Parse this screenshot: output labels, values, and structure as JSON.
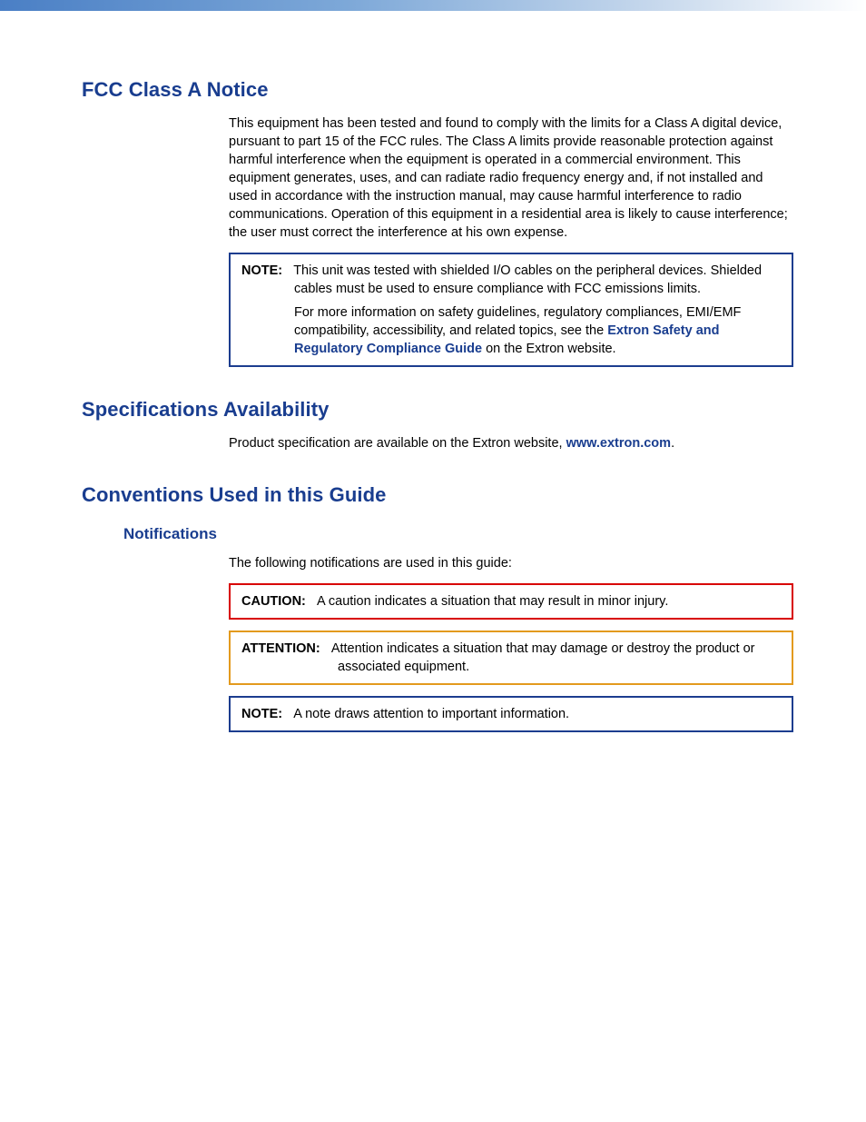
{
  "fcc": {
    "heading": "FCC Class A Notice",
    "body": "This equipment has been tested and found to comply with the limits for a Class A digital device, pursuant to part 15 of the FCC rules. The Class A limits provide reasonable protection against harmful interference when the equipment is operated in a commercial environment. This equipment generates, uses, and can radiate radio frequency energy and, if not installed and used in accordance with the instruction manual, may cause harmful interference to radio communications. Operation of this equipment in a residential area is likely to cause interference; the user must correct the interference at his own expense.",
    "note": {
      "label": "NOTE:",
      "p1": "This unit was tested with shielded I/O cables on the peripheral devices. Shielded cables must be used to ensure compliance with FCC emissions limits.",
      "p2a": "For more information on safety guidelines, regulatory compliances, EMI/EMF compatibility, accessibility, and related topics, see the ",
      "link": "Extron Safety and Regulatory Compliance Guide",
      "p2b": " on the Extron website."
    }
  },
  "spec": {
    "heading": "Specifications Availability",
    "body_a": "Product specification are available on the Extron website, ",
    "link": "www.extron.com",
    "body_b": "."
  },
  "conv": {
    "heading": "Conventions Used in this Guide",
    "sub": "Notifications",
    "intro": "The following notifications are used in this guide:",
    "caution": {
      "label": "CAUTION:",
      "text": "A caution indicates a situation that may result in minor injury."
    },
    "attention": {
      "label": "ATTENTION:",
      "text": "Attention indicates a situation that may damage or destroy the product or associated equipment."
    },
    "note": {
      "label": "NOTE:",
      "text": "A note draws attention to important information."
    }
  }
}
